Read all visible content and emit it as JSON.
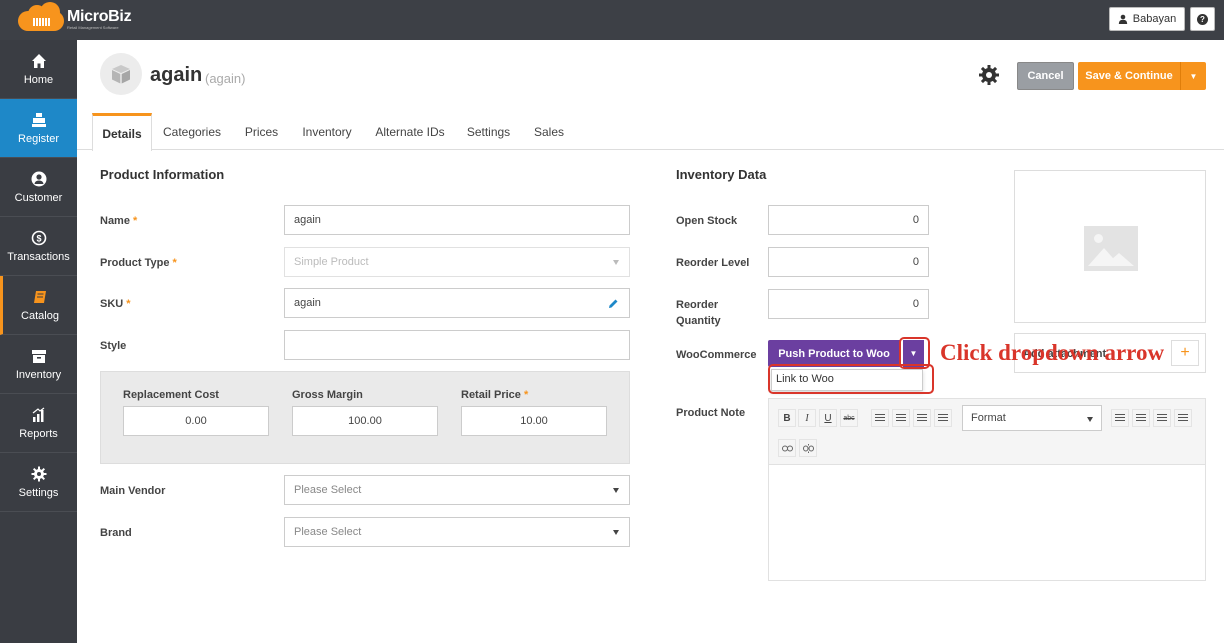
{
  "app": {
    "brand": "MicroBiz",
    "brand_sub": "Retail Management Software",
    "user": "Babayan",
    "help": "?"
  },
  "sidebar": {
    "items": [
      {
        "label": "Home",
        "icon": "home-icon"
      },
      {
        "label": "Register",
        "icon": "register-icon",
        "active": true
      },
      {
        "label": "Customer",
        "icon": "customer-icon"
      },
      {
        "label": "Transactions",
        "icon": "transactions-icon"
      },
      {
        "label": "Catalog",
        "icon": "catalog-icon"
      },
      {
        "label": "Inventory",
        "icon": "inventory-icon"
      },
      {
        "label": "Reports",
        "icon": "reports-icon"
      },
      {
        "label": "Settings",
        "icon": "settings-icon"
      }
    ]
  },
  "header": {
    "title": "again",
    "subtitle": "(again)",
    "cancel": "Cancel",
    "save": "Save & Continue"
  },
  "tabs": [
    {
      "label": "Details",
      "active": true
    },
    {
      "label": "Categories"
    },
    {
      "label": "Prices"
    },
    {
      "label": "Inventory"
    },
    {
      "label": "Alternate IDs"
    },
    {
      "label": "Settings"
    },
    {
      "label": "Sales"
    }
  ],
  "product_info": {
    "title": "Product Information",
    "name_label": "Name",
    "name_value": "again",
    "type_label": "Product Type",
    "type_value": "Simple Product",
    "sku_label": "SKU",
    "sku_value": "again",
    "style_label": "Style",
    "style_value": "",
    "replacement_cost_label": "Replacement Cost",
    "replacement_cost_value": "0.00",
    "gross_margin_label": "Gross Margin",
    "gross_margin_value": "100.00",
    "retail_price_label": "Retail Price",
    "retail_price_value": "10.00",
    "vendor_label": "Main Vendor",
    "vendor_value": "Please Select",
    "brand_label": "Brand",
    "brand_value": "Please Select",
    "required_mark": "*"
  },
  "inventory_data": {
    "title": "Inventory Data",
    "open_stock_label": "Open Stock",
    "open_stock_value": "0",
    "reorder_level_label": "Reorder Level",
    "reorder_level_value": "0",
    "reorder_qty_label_1": "Reorder",
    "reorder_qty_label_2": "Quantity",
    "reorder_qty_value": "0",
    "woo_label": "WooCommerce",
    "woo_button": "Push Product to Woo",
    "woo_menu_item": "Link to Woo",
    "note_label": "Product Note",
    "format_label": "Format"
  },
  "attachments": {
    "label": "Add attachment"
  },
  "annotation": "Click dropdown arrow",
  "colors": {
    "accent": "#f7941d",
    "sidebar_active": "#1e88c8",
    "woo_purple": "#6b3fa0",
    "annotation_red": "#d9352a"
  }
}
